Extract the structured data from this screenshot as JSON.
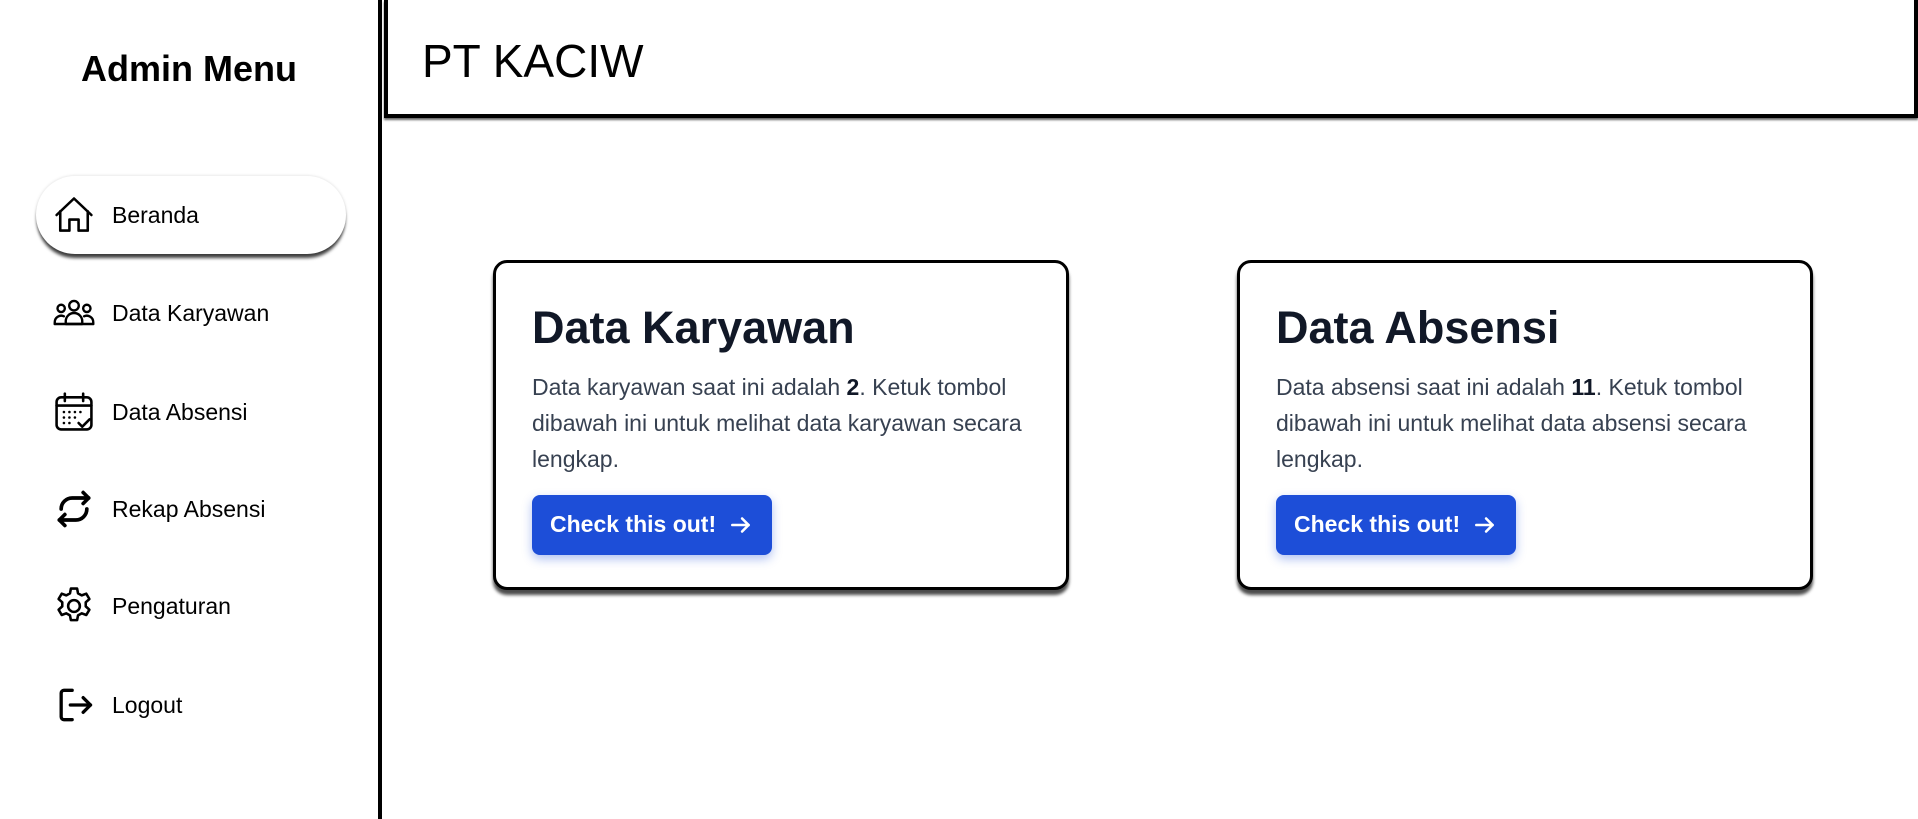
{
  "sidebar": {
    "title": "Admin Menu",
    "items": [
      {
        "label": "Beranda",
        "icon": "home-icon",
        "active": true
      },
      {
        "label": "Data Karyawan",
        "icon": "users-icon",
        "active": false
      },
      {
        "label": "Data Absensi",
        "icon": "calendar-check-icon",
        "active": false
      },
      {
        "label": "Rekap Absensi",
        "icon": "refresh-icon",
        "active": false
      },
      {
        "label": "Pengaturan",
        "icon": "gear-icon",
        "active": false
      },
      {
        "label": "Logout",
        "icon": "logout-icon",
        "active": false
      }
    ]
  },
  "header": {
    "title": "PT KACIW"
  },
  "cards": [
    {
      "title": "Data Karyawan",
      "text_before": "Data karyawan saat ini adalah ",
      "count": "2",
      "text_after": ". Ketuk tombol dibawah ini untuk melihat data karyawan secara lengkap.",
      "button_label": "Check this out!"
    },
    {
      "title": "Data Absensi",
      "text_before": "Data absensi saat ini adalah ",
      "count": "11",
      "text_after": ". Ketuk tombol dibawah ini untuk melihat data absensi secara lengkap.",
      "button_label": "Check this out!"
    }
  ],
  "colors": {
    "accent": "#1d4ed8",
    "border": "#000000",
    "text": "#111827"
  }
}
